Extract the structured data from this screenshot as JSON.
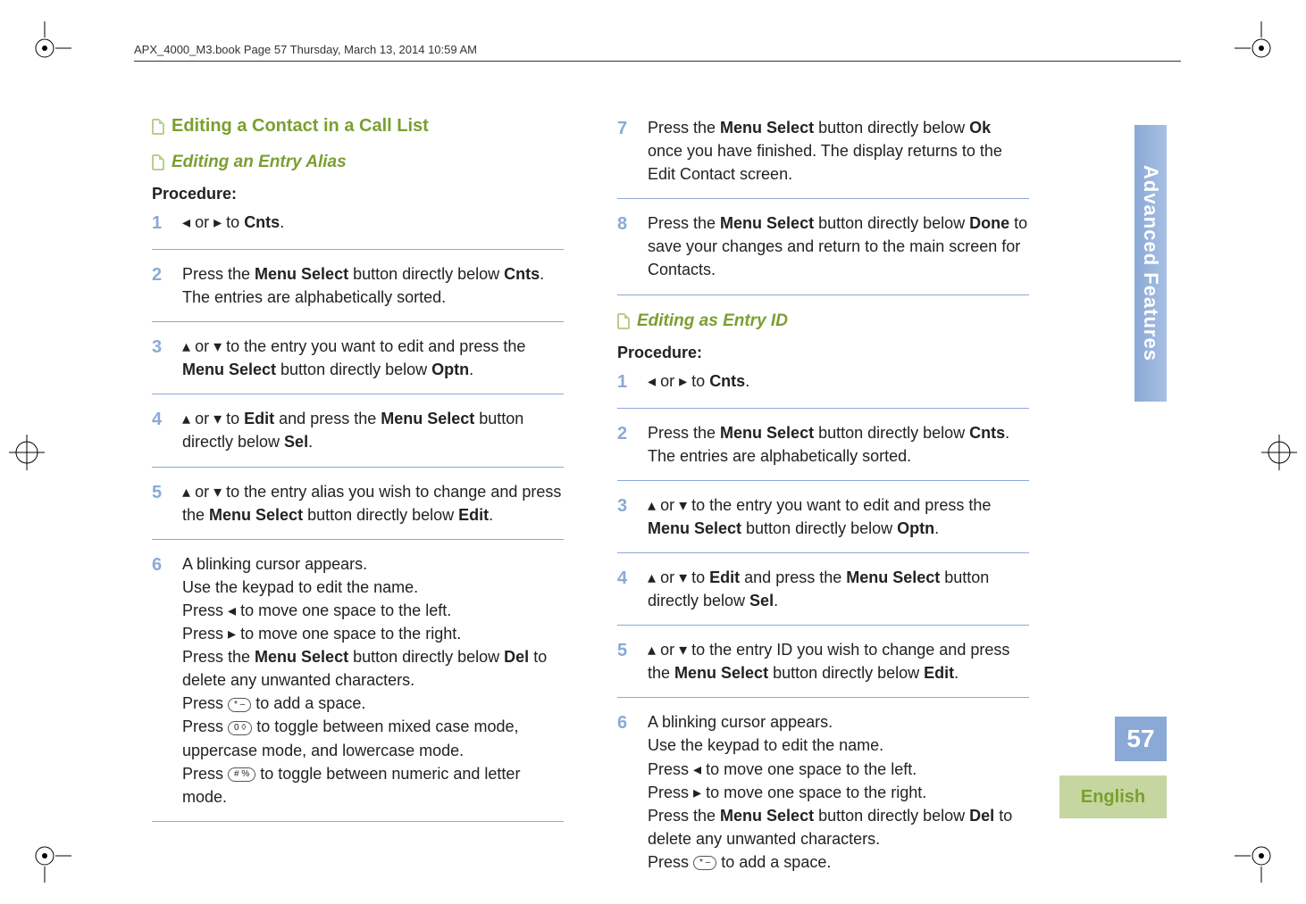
{
  "header": {
    "running": "APX_4000_M3.book  Page 57  Thursday, March 13, 2014  10:59 AM"
  },
  "sidetab": {
    "label": "Advanced Features"
  },
  "pagenum": "57",
  "language": "English",
  "left": {
    "section_title": "Editing a Contact in a Call List",
    "subsection_title": "Editing an Entry Alias",
    "procedure_label": "Procedure:",
    "steps": {
      "s1": {
        "num": "1",
        "prefix": "",
        "tri_or": "or",
        "to": "to",
        "target": "Cnts",
        "suffix": "."
      },
      "s2": {
        "num": "2",
        "prefix": "Press the ",
        "b1": "Menu Select",
        "mid": " button directly below ",
        "target": "Cnts",
        "suffix": ". The entries are alphabetically sorted."
      },
      "s3": {
        "num": "3",
        "tri_or": "or",
        "mid": " to the entry you want to edit and press the ",
        "b1": "Menu Select",
        "tail": " button directly below ",
        "target": "Optn",
        "suffix": "."
      },
      "s4": {
        "num": "4",
        "tri_or": "or",
        "to": " to ",
        "target1": "Edit",
        "mid": " and press the ",
        "b1": "Menu Select",
        "tail": " button directly below ",
        "target2": "Sel",
        "suffix": "."
      },
      "s5": {
        "num": "5",
        "tri_or": "or",
        "mid": " to the entry alias you wish to change and press the ",
        "b1": "Menu Select",
        "tail": " button directly below ",
        "target": "Edit",
        "suffix": "."
      },
      "s6": {
        "num": "6",
        "l1": "A blinking cursor appears.",
        "l2": "Use the keypad to edit the name.",
        "l3_a": "Press ",
        "l3_b": " to move one space to the left.",
        "l4_a": "Press ",
        "l4_b": " to move one space to the right.",
        "l5_a": "Press the ",
        "l5_b": "Menu Select",
        "l5_c": " button directly below ",
        "l5_t": "Del",
        "l5_d": " to delete any unwanted characters.",
        "l6_a": "Press ",
        "l6_key": "* –",
        "l6_b": " to add a space.",
        "l7_a": "Press ",
        "l7_key": "0 ◊",
        "l7_b": " to toggle between mixed case mode, uppercase mode, and lowercase mode.",
        "l8_a": "Press ",
        "l8_key": "# %",
        "l8_b": " to toggle between numeric and letter mode."
      }
    }
  },
  "right": {
    "subsection_title": "Editing as Entry ID",
    "procedure_label": "Procedure:",
    "top": {
      "s7": {
        "num": "7",
        "prefix": "Press the ",
        "b1": "Menu Select",
        "mid": " button directly below ",
        "target": "Ok",
        "suffix": " once you have finished. The display returns to the Edit Contact screen."
      },
      "s8": {
        "num": "8",
        "prefix": "Press the ",
        "b1": "Menu Select",
        "mid": " button directly below ",
        "target": "Done",
        "suffix": " to save your changes and return to the main screen for Contacts."
      }
    },
    "steps": {
      "s1": {
        "num": "1",
        "tri_or": "or",
        "to": "to",
        "target": "Cnts",
        "suffix": "."
      },
      "s2": {
        "num": "2",
        "prefix": "Press the ",
        "b1": "Menu Select",
        "mid": " button directly below ",
        "target": "Cnts",
        "suffix": ". The entries are alphabetically sorted."
      },
      "s3": {
        "num": "3",
        "tri_or": "or",
        "mid": " to the entry you want to edit and press the ",
        "b1": "Menu Select",
        "tail": " button directly below ",
        "target": "Optn",
        "suffix": "."
      },
      "s4": {
        "num": "4",
        "tri_or": "or",
        "to": " to ",
        "target1": "Edit",
        "mid": " and press the ",
        "b1": "Menu Select",
        "tail": " button directly below ",
        "target2": "Sel",
        "suffix": "."
      },
      "s5": {
        "num": "5",
        "tri_or": "or",
        "mid": " to the entry ID you wish to change and press the ",
        "b1": "Menu Select",
        "tail": " button directly below ",
        "target": "Edit",
        "suffix": "."
      },
      "s6": {
        "num": "6",
        "l1": "A blinking cursor appears.",
        "l2": "Use the keypad to edit the name.",
        "l3_a": "Press ",
        "l3_b": " to move one space to the left.",
        "l4_a": "Press ",
        "l4_b": " to move one space to the right.",
        "l5_a": "Press the ",
        "l5_b": "Menu Select",
        "l5_c": " button directly below ",
        "l5_t": "Del",
        "l5_d": " to delete any unwanted characters.",
        "l6_a": "Press ",
        "l6_key": "* –",
        "l6_b": " to add a space."
      }
    }
  }
}
